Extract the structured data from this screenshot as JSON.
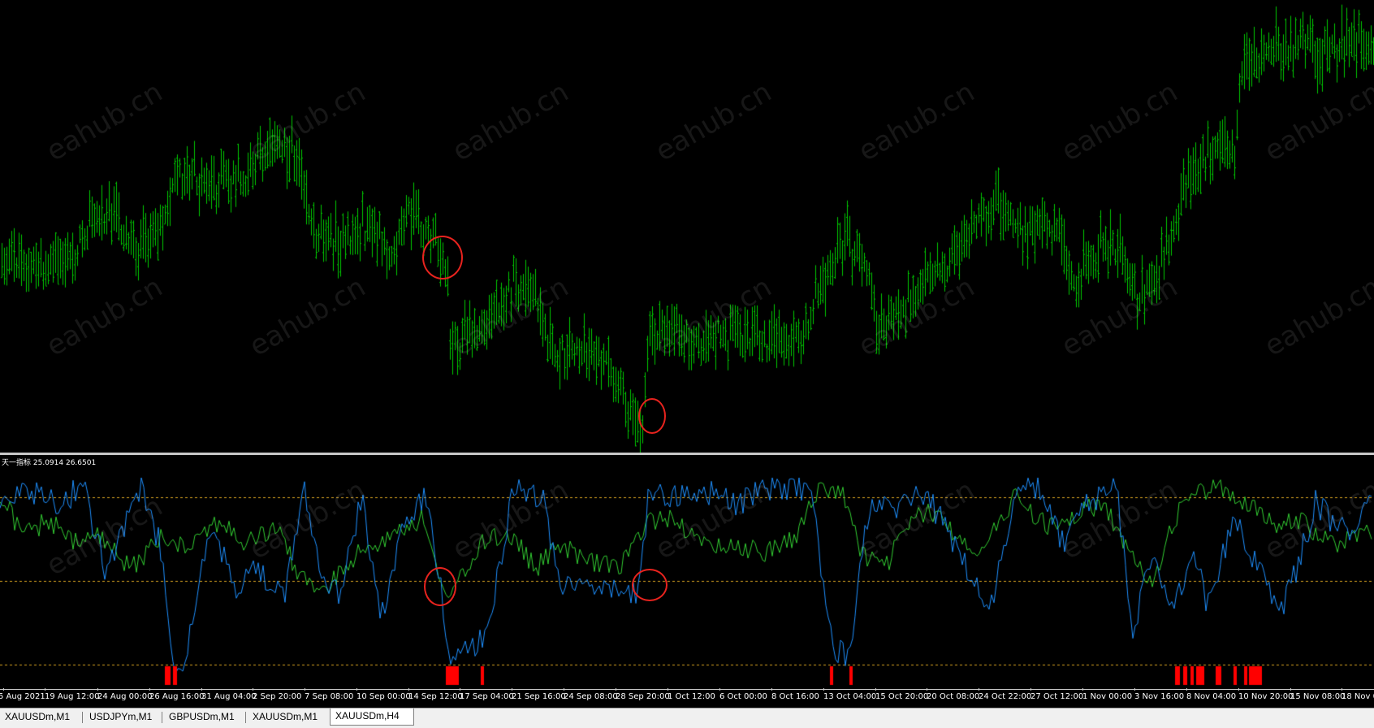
{
  "indicator": {
    "label_prefix": "天一指标",
    "value1": "25.0914",
    "value2": "26.6501"
  },
  "time_axis": {
    "ticks": [
      "5 Aug 2021",
      "19 Aug 12:00",
      "24 Aug 00:00",
      "26 Aug 16:00",
      "31 Aug 04:00",
      "2 Sep 20:00",
      "7 Sep 08:00",
      "10 Sep 00:00",
      "14 Sep 12:00",
      "17 Sep 04:00",
      "21 Sep 16:00",
      "24 Sep 08:00",
      "28 Sep 20:00",
      "1 Oct 12:00",
      "6 Oct 00:00",
      "8 Oct 16:00",
      "13 Oct 04:00",
      "15 Oct 20:00",
      "20 Oct 08:00",
      "24 Oct 22:00",
      "27 Oct 12:00",
      "1 Nov 00:00",
      "3 Nov 16:00",
      "8 Nov 04:00",
      "10 Nov 20:00",
      "15 Nov 08:00",
      "18 Nov 0"
    ]
  },
  "tabs": [
    {
      "label": "XAUUSDm,M1",
      "active": false
    },
    {
      "label": "USDJPYm,M1",
      "active": false
    },
    {
      "label": "GBPUSDm,M1",
      "active": false
    },
    {
      "label": "XAUUSDm,M1",
      "active": false
    },
    {
      "label": "XAUUSDm,H4",
      "active": true
    }
  ],
  "watermark_text": "eahub.cn",
  "colors": {
    "price_bars": "#00c800",
    "blue_line": "#1e90ff",
    "green_line": "#32cd32",
    "level_lines": "#daa520",
    "histogram": "#ff0000",
    "annotation_circles": "#e8231e",
    "background": "#000000"
  }
}
